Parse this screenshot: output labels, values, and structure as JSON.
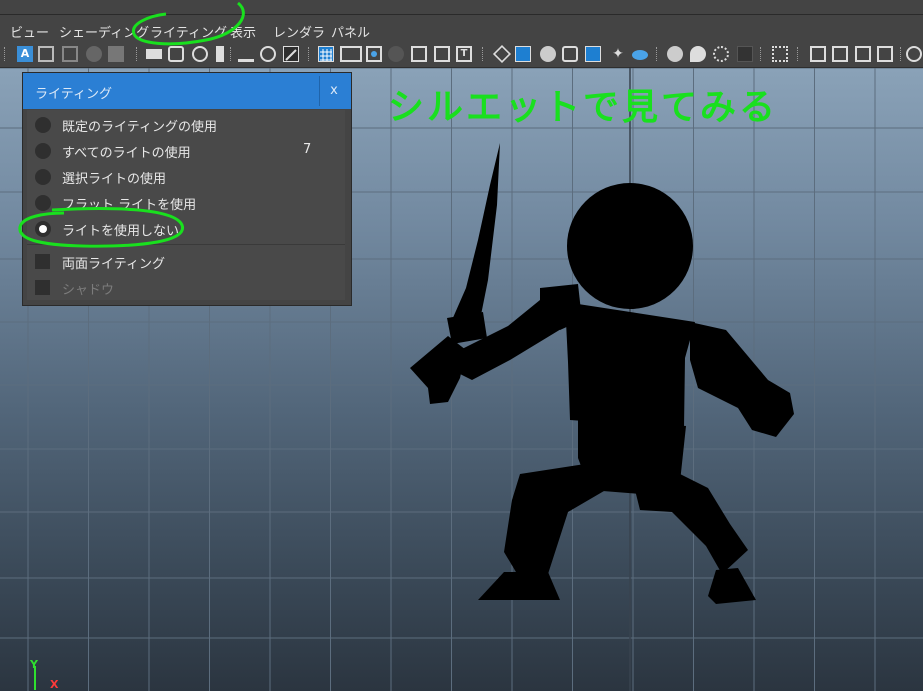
{
  "menubar": {
    "items": [
      "ビュー",
      "シェーディング",
      "ライティング",
      "表示",
      "レンダラ",
      "パネル"
    ]
  },
  "viewport": {
    "overlay_text": "シルエットで見てみる",
    "axis": {
      "y": "Y",
      "x": "X"
    }
  },
  "lighting_panel": {
    "title": "ライティング",
    "close": "x",
    "options": [
      {
        "label": "既定のライティングの使用",
        "type": "radio",
        "checked": false
      },
      {
        "label": "すべてのライトの使用",
        "type": "radio",
        "checked": false,
        "count": "7"
      },
      {
        "label": "選択ライトの使用",
        "type": "radio",
        "checked": false
      },
      {
        "label": "フラット ライトを使用",
        "type": "radio",
        "checked": false
      },
      {
        "label": "ライトを使用しない",
        "type": "radio",
        "checked": true
      },
      {
        "label": "両面ライティング",
        "type": "checkbox",
        "checked": false
      },
      {
        "label": "シャドウ",
        "type": "checkbox",
        "checked": false,
        "disabled": true
      }
    ]
  },
  "toolbar": {
    "icons": [
      "select-camera-icon",
      "camera-attributes-icon",
      "bookmark-icon",
      "image-plane-icon",
      "2d-pan-zoom-icon",
      "grease-pencil-icon",
      "grid-icon",
      "film-gate-icon",
      "resolution-gate-icon",
      "gate-mask-icon",
      "field-chart-icon",
      "safe-action-icon",
      "safe-title-icon",
      "wireframe-icon",
      "smooth-shade-icon",
      "use-default-material-icon",
      "wireframe-on-shaded-icon",
      "xray-icon",
      "lights-icon",
      "shadows-icon",
      "screen-space-ao-icon",
      "motion-blur-icon",
      "multisample-aa-icon",
      "depth-of-field-icon",
      "isolate-select-icon",
      "xray-joints-icon",
      "xray-active-icon",
      "single-pane-icon",
      "four-pane-icon",
      "frame-all-icon",
      "exposure-icon"
    ]
  },
  "colors": {
    "menu_bg": "#444444",
    "panel_header": "#2b7fd4",
    "annotation_green": "#19e01e",
    "silhouette": "#000000"
  }
}
